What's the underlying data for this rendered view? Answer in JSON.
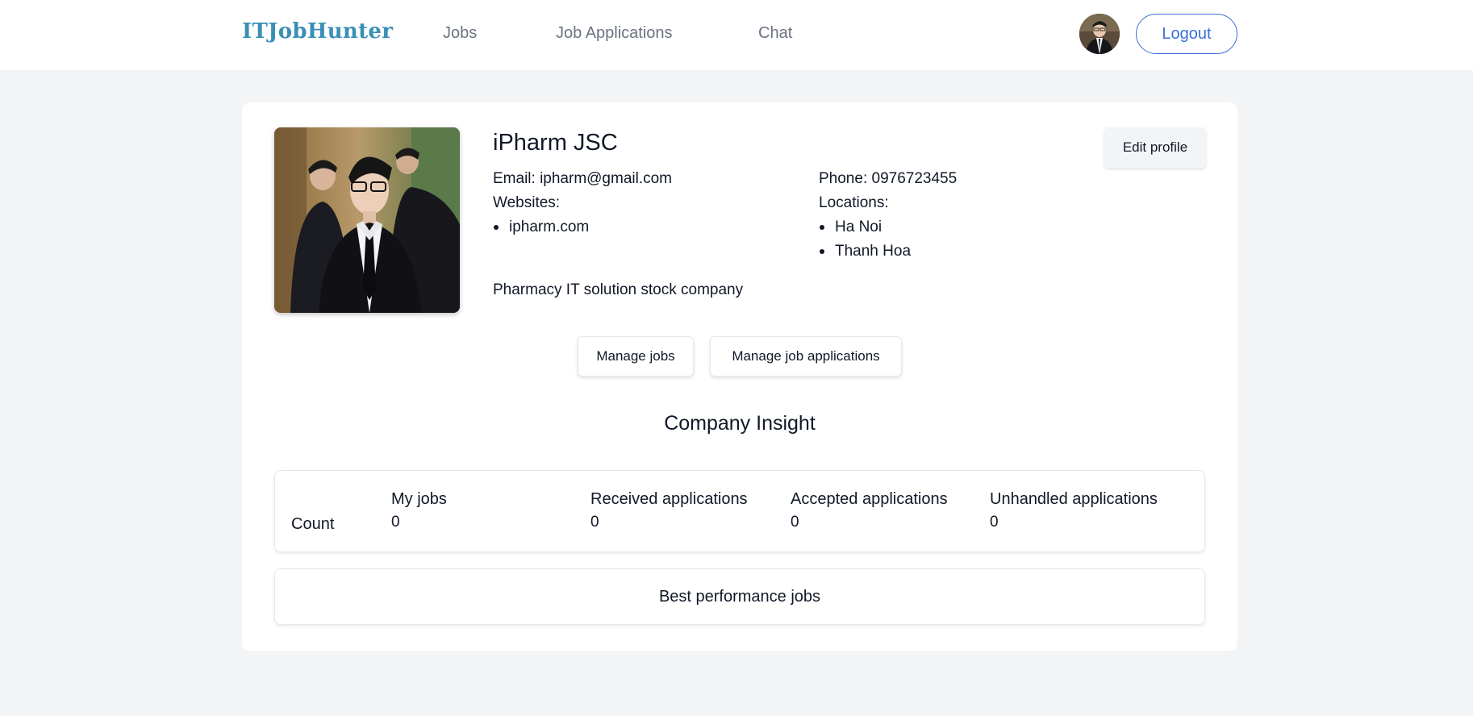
{
  "header": {
    "logo": "ITJobHunter",
    "nav": [
      {
        "label": "Jobs"
      },
      {
        "label": "Job Applications"
      },
      {
        "label": "Chat"
      }
    ],
    "logout_label": "Logout"
  },
  "profile": {
    "name": "iPharm JSC",
    "email_label": "Email: ipharm@gmail.com",
    "phone_label": "Phone: 0976723455",
    "websites_label": "Websites:",
    "websites": [
      "ipharm.com"
    ],
    "locations_label": "Locations:",
    "locations": [
      "Ha Noi",
      "Thanh Hoa"
    ],
    "description": "Pharmacy IT solution stock company",
    "edit_label": "Edit profile"
  },
  "actions": {
    "manage_jobs": "Manage jobs",
    "manage_applications": "Manage job applications"
  },
  "insight": {
    "title": "Company Insight",
    "row_label": "Count",
    "columns": [
      {
        "header": "My jobs",
        "value": "0"
      },
      {
        "header": "Received applications",
        "value": "0"
      },
      {
        "header": "Accepted applications",
        "value": "0"
      },
      {
        "header": "Unhandled applications",
        "value": "0"
      }
    ],
    "best_jobs_label": "Best performance jobs"
  },
  "colors": {
    "brand": "#3a8fb7",
    "accent": "#3b6fd6",
    "background": "#f3f4f6"
  }
}
